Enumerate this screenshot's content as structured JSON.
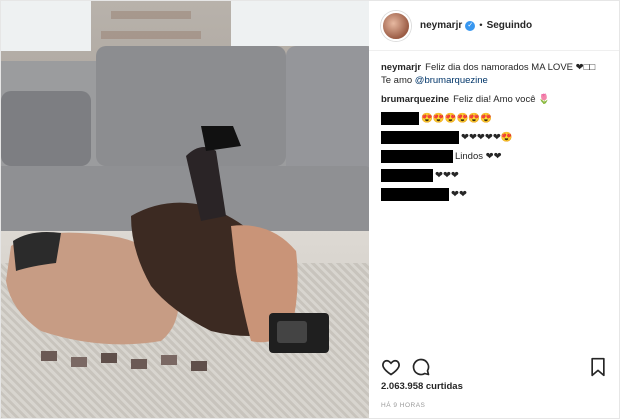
{
  "post": {
    "username": "neymarjr",
    "follow_status": "Seguindo",
    "separator": "•",
    "verified_glyph": "✓",
    "caption_user": "neymarjr",
    "caption_text": "Feliz dia dos namorados MA LOVE ❤□□ Te amo",
    "caption_mention": "@brumarquezine",
    "reply_user": "brumarquezine",
    "reply_text": "Feliz dia! Amo você 🌷",
    "redacted_comments": [
      {
        "suffix": "😍😍😍😍😍😍"
      },
      {
        "suffix": "❤❤❤❤❤😍"
      },
      {
        "suffix": "Lindos ❤❤"
      },
      {
        "suffix": "❤❤❤"
      },
      {
        "suffix": "❤❤"
      }
    ],
    "likes": "2.063.958 curtidas",
    "time_ago": "HÁ 9 HORAS"
  },
  "icons": {
    "like": "heart-outline-icon",
    "comment": "comment-bubble-icon",
    "save": "bookmark-icon"
  },
  "colors": {
    "verified": "#3897f0",
    "mention": "#003569",
    "border": "#e6e6e6"
  }
}
